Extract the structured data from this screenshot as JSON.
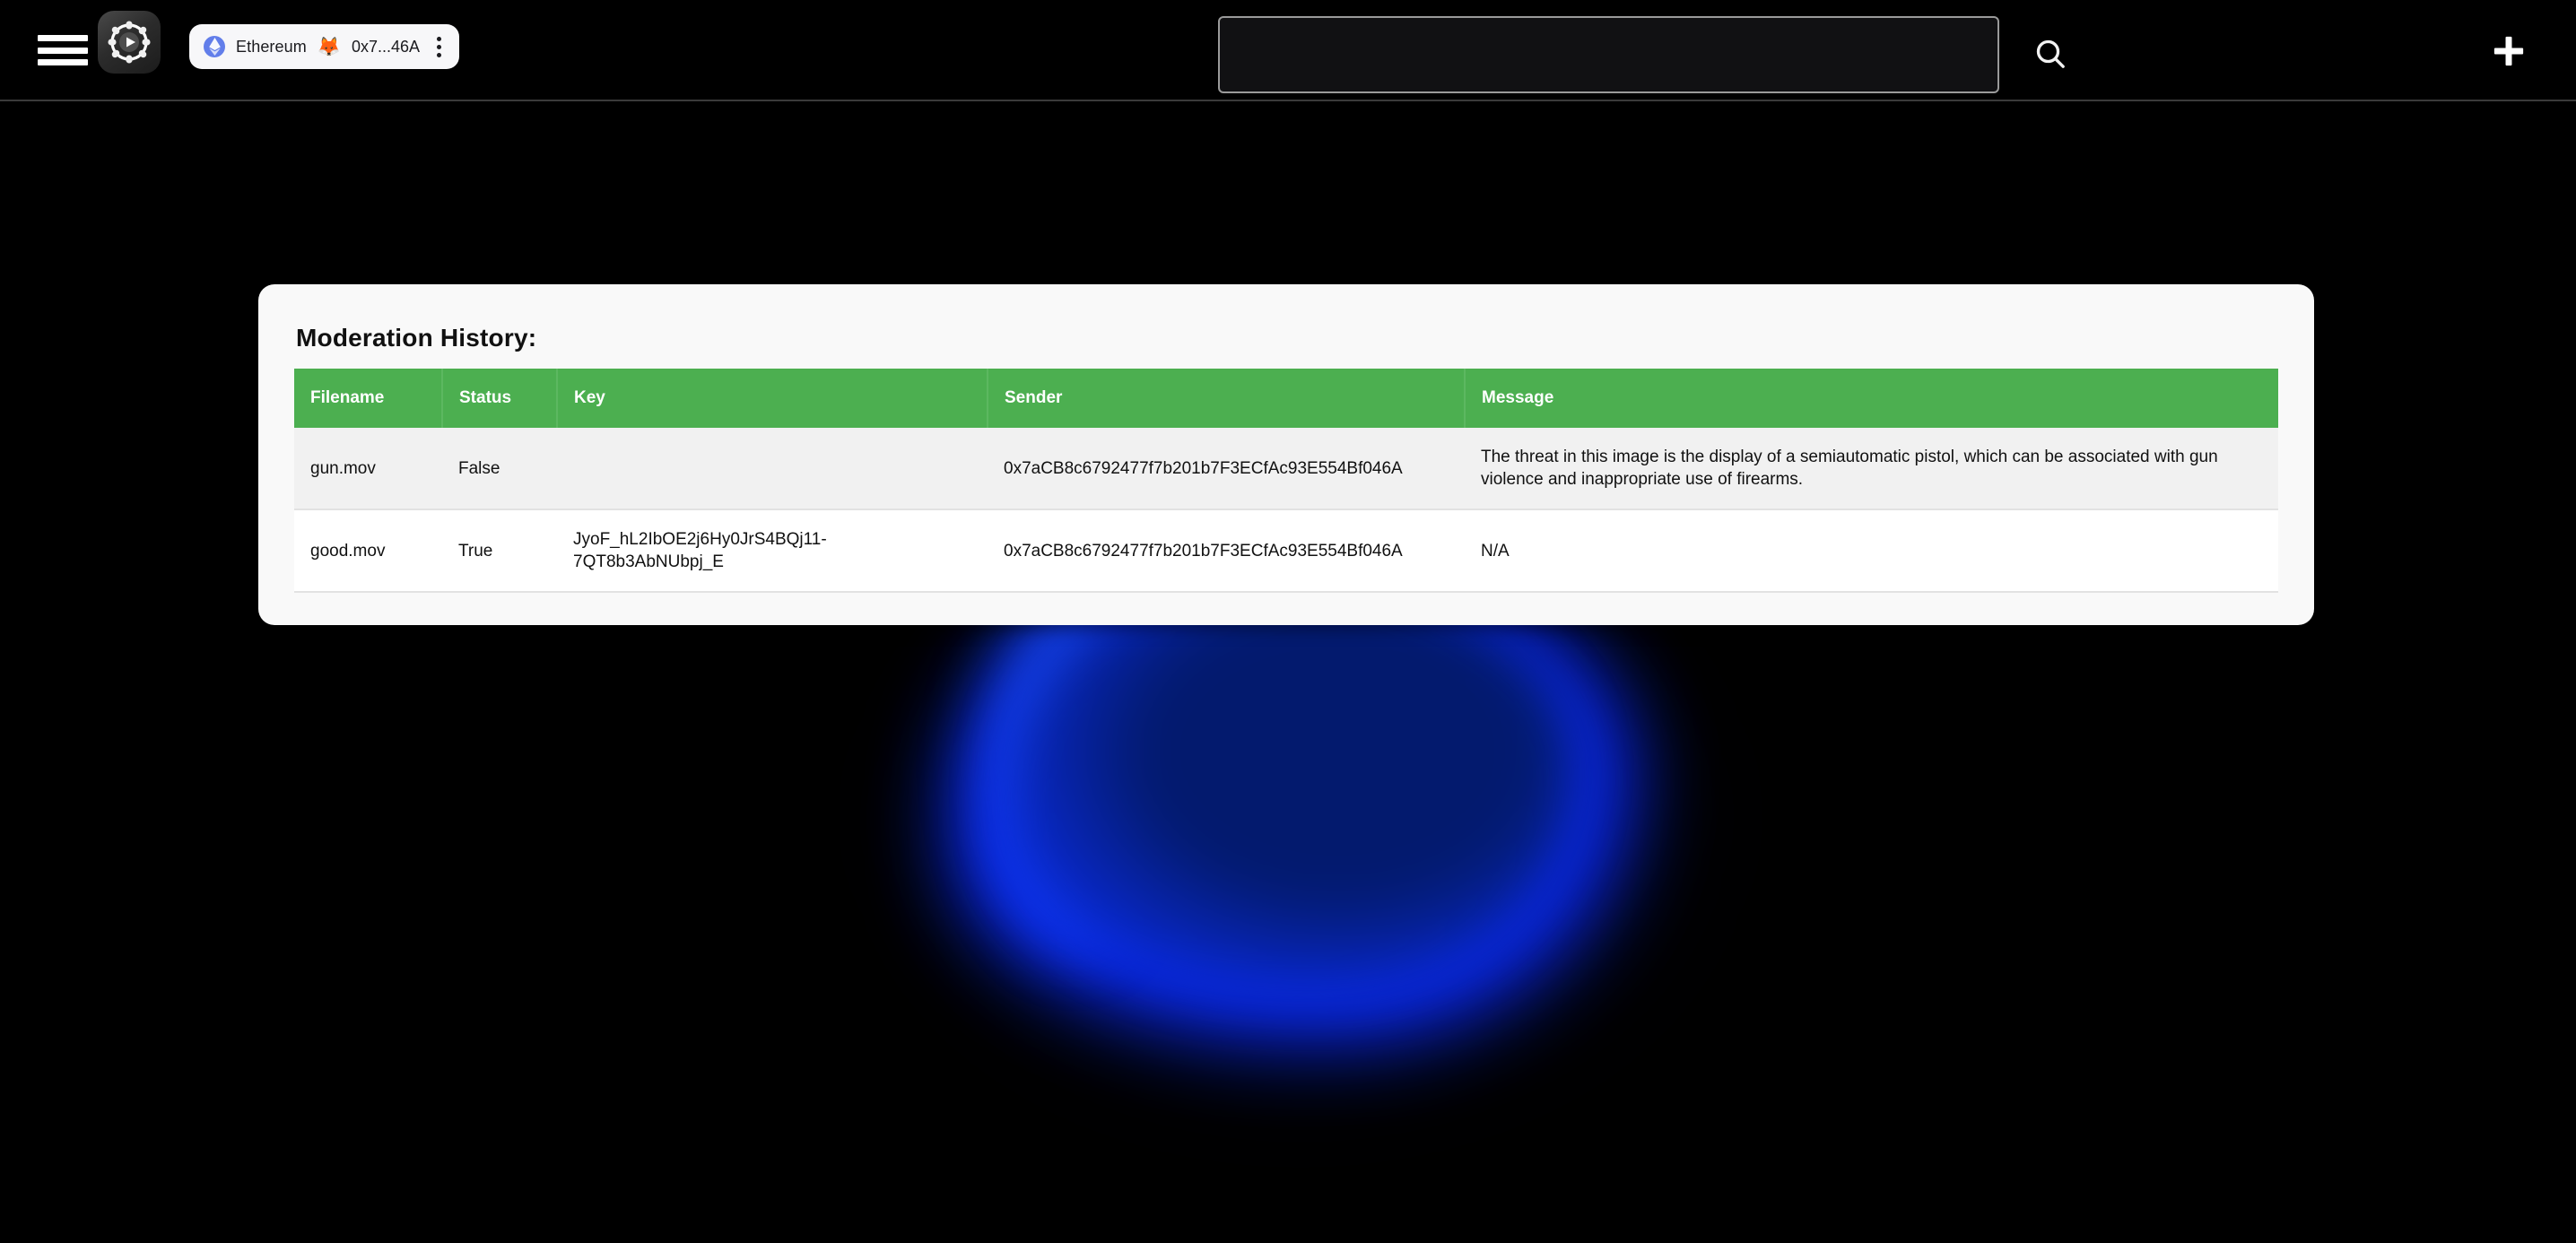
{
  "topbar": {
    "menu_icon": "hamburger-icon",
    "logo_icon": "chainplay-logo-icon",
    "wallet": {
      "network_icon": "ethereum-icon",
      "network_label": "Ethereum",
      "wallet_icon": "metamask-fox-icon",
      "address_label": "0x7...46A",
      "menu_icon": "vertical-dots-icon"
    },
    "search": {
      "value": "",
      "placeholder": "",
      "button_icon": "search-icon"
    },
    "add_button_icon": "plus-icon"
  },
  "card": {
    "title": "Moderation History:",
    "table": {
      "columns": [
        "Filename",
        "Status",
        "Key",
        "Sender",
        "Message"
      ],
      "rows": [
        {
          "filename": "gun.mov",
          "status": "False",
          "key": "",
          "sender": "0x7aCB8c6792477f7b201b7F3ECfAc93E554Bf046A",
          "message": "The threat in this image is the display of a semiautomatic pistol, which can be associated with gun violence and inappropriate use of firearms."
        },
        {
          "filename": "good.mov",
          "status": "True",
          "key": "JyoF_hL2IbOE2j6Hy0JrS4BQj11-7QT8b3AbNUbpj_E",
          "sender": "0x7aCB8c6792477f7b201b7F3ECfAc93E554Bf046A",
          "message": "N/A"
        }
      ]
    }
  },
  "colors": {
    "background": "#000000",
    "card_background": "#f9f9f9",
    "table_header_green": "#4caf50",
    "row_alt": "#f1f1f1",
    "accent_blue": "#0b2cff",
    "ethereum_purple": "#627eea",
    "text_dark": "#111111",
    "border_grey": "#9a9a9a"
  }
}
